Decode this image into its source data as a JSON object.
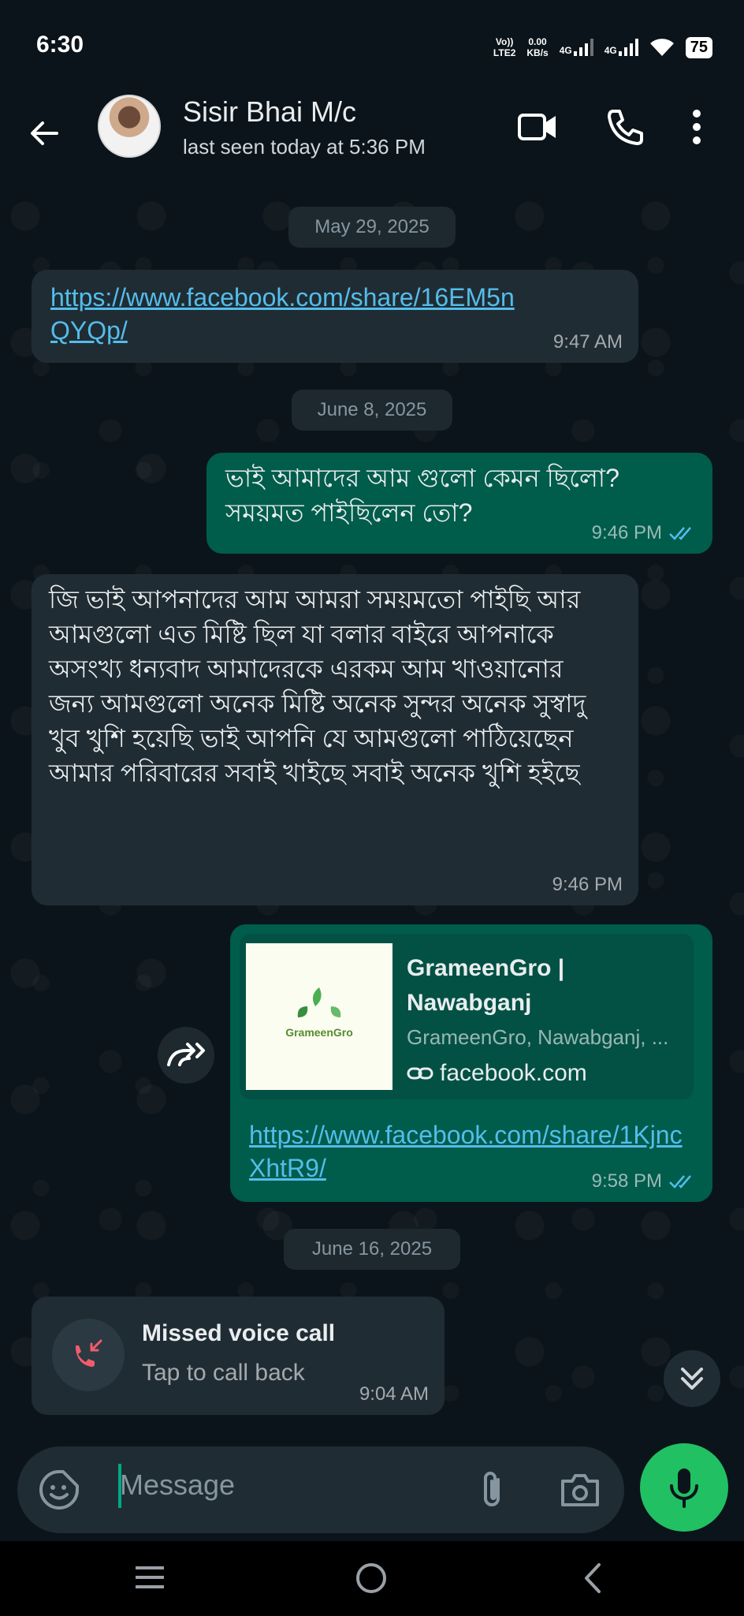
{
  "status": {
    "time": "6:30",
    "volte_label": "Vo))",
    "lte_label": "LTE2",
    "speed_value": "0.00",
    "speed_unit": "KB/s",
    "net1": "4G",
    "net2": "4G",
    "battery": "75"
  },
  "header": {
    "name": "Sisir Bhai M/c",
    "last_seen": "last seen today at 5:36 PM",
    "icons": [
      "arrow-back-icon",
      "video-call-icon",
      "voice-call-icon",
      "more-vert-icon"
    ]
  },
  "chat": {
    "dates": [
      "May 29, 2025",
      "June 8, 2025",
      "June 16, 2025"
    ],
    "msg1": {
      "link": "https://www.facebook.com/share/16EM5nQYQp/",
      "time": "9:47 AM"
    },
    "msg2": {
      "text": "ভাই আমাদের আম গুলো কেমন ছিলো? সময়মত পাইছিলেন তো?",
      "time": "9:46 PM"
    },
    "msg3": {
      "text": "জি ভাই আপনাদের আম আমরা সময়মতো পাইছি আর আমগুলো এত মিষ্টি ছিল যা বলার বাইরে আপনাকে অসংখ্য ধন্যবাদ আমাদেরকে এরকম আম খাওয়ানোর জন্য আমগুলো অনেক মিষ্টি অনেক সুন্দর অনেক সুস্বাদু খুব খুশি হয়েছি ভাই আপনি যে আমগুলো পাঠিয়েছেন আমার পরিবারের সবাই খাইছে সবাই অনেক খুশি হইছে",
      "time": "9:46 PM"
    },
    "msg4": {
      "preview_title": "GrameenGro | Nawabganj",
      "preview_desc": "GrameenGro, Nawabganj, ...",
      "preview_domain": "facebook.com",
      "logo_text": "GrameenGro",
      "link": "https://www.facebook.com/share/1KjncXhtR9/",
      "time": "9:58 PM"
    },
    "missed_call": {
      "title": "Missed voice call",
      "subtitle": "Tap to call back",
      "time": "9:04 AM"
    }
  },
  "composer": {
    "placeholder": "Message"
  },
  "colors": {
    "background": "#0b141a",
    "incoming_bubble": "#202c33",
    "outgoing_bubble": "#005c4b",
    "link": "#53bdeb",
    "accent": "#21c063",
    "read_tick": "#53bdeb"
  }
}
